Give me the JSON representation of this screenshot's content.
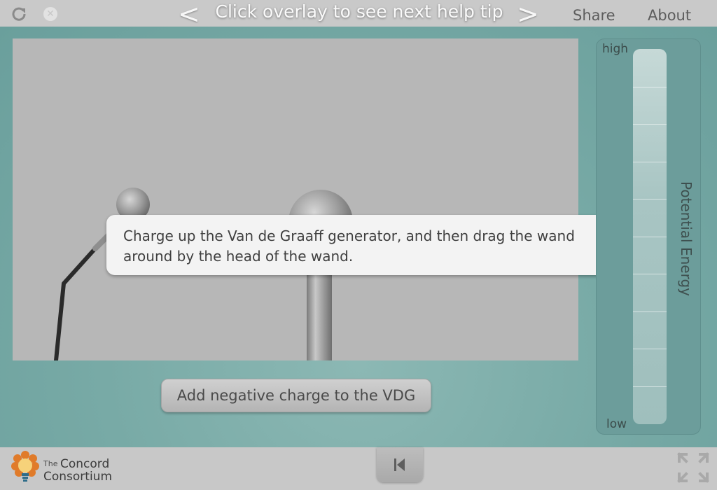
{
  "toolbar": {
    "reload_icon": "reload-icon",
    "close_icon": "close-icon",
    "prev_label": "<",
    "next_label": ">",
    "help_title": "Click overlay to see next help tip",
    "share_label": "Share",
    "about_label": "About"
  },
  "simulation": {
    "tooltip_text": "Charge up the Van de Graaff generator, and then drag the wand around by the head of the wand.",
    "button_label": "Add negative charge to the VDG"
  },
  "energy_meter": {
    "title": "Potential Energy",
    "high_label": "high",
    "low_label": "low",
    "level": 0.0
  },
  "footer": {
    "logo_small": "The",
    "logo_line1": "Concord",
    "logo_line2": "Consortium",
    "rewind_icon": "rewind-to-start-icon",
    "fullscreen_icon": "fullscreen-icon"
  },
  "colors": {
    "teal_background": "#78aaa6",
    "sim_background": "#b7b7b7",
    "top_bar": "#c9c9c9"
  }
}
